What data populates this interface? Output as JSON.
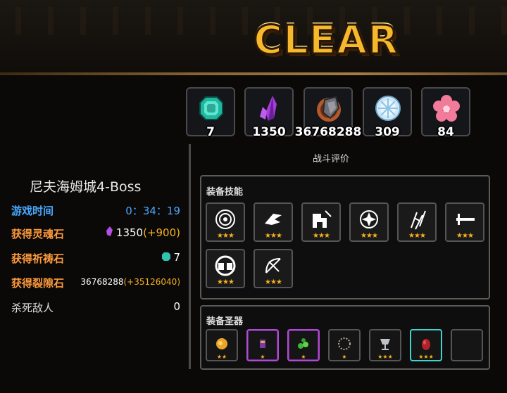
{
  "banner": {
    "clear_text": "CLEAR"
  },
  "resources": [
    {
      "icon": "teal-gem-icon",
      "value": "7"
    },
    {
      "icon": "purple-crystal-icon",
      "value": "1350"
    },
    {
      "icon": "rift-stone-icon",
      "value": "36768288"
    },
    {
      "icon": "snowflake-orb-icon",
      "value": "309"
    },
    {
      "icon": "pink-flower-icon",
      "value": "84"
    }
  ],
  "rating_label": "战斗评价",
  "stage": {
    "title": "尼夫海姆城4-Boss",
    "rows": [
      {
        "label": "游戏时间",
        "value": "0：34：19",
        "label_color": "#4aa7ff",
        "value_color": "#4aa7ff"
      },
      {
        "label": "获得灵魂石",
        "value": "1350",
        "bonus": "(+900)",
        "label_color": "#ff9b3d"
      },
      {
        "label": "获得祈祷石",
        "value": "7",
        "label_color": "#ff9b3d"
      },
      {
        "label": "获得裂隙石",
        "value": "36768288",
        "bonus": "(+35126040)",
        "label_color": "#ff9b3d"
      },
      {
        "label": "杀死敌人",
        "value": "0",
        "label_color": "#e0e0e0"
      }
    ]
  },
  "skills_panel": {
    "title": "装备技能",
    "skills": [
      {
        "icon": "target-eye-icon",
        "stars": "★★★"
      },
      {
        "icon": "wing-dash-icon",
        "stars": "★★★"
      },
      {
        "icon": "strike-fist-icon",
        "stars": "★★★"
      },
      {
        "icon": "shuriken-spin-icon",
        "stars": "★★★"
      },
      {
        "icon": "daggers-rain-icon",
        "stars": "★★★"
      },
      {
        "icon": "thrust-sword-icon",
        "stars": "★★★"
      },
      {
        "icon": "helm-shield-icon",
        "stars": "★★★"
      },
      {
        "icon": "bow-arrow-icon",
        "stars": "★★★"
      }
    ]
  },
  "relics_panel": {
    "title": "装备圣器",
    "relics": [
      {
        "icon": "golden-lion-icon",
        "stars": "★★",
        "frame": "normal"
      },
      {
        "icon": "purple-idol-icon",
        "stars": "★",
        "frame": "purple"
      },
      {
        "icon": "green-seeds-icon",
        "stars": "★",
        "frame": "purple"
      },
      {
        "icon": "bead-necklace-icon",
        "stars": "★",
        "frame": "normal"
      },
      {
        "icon": "silver-chalice-icon",
        "stars": "★★★",
        "frame": "normal"
      },
      {
        "icon": "red-egg-icon",
        "stars": "★★★",
        "frame": "cyan"
      },
      {
        "icon": "empty-slot",
        "stars": "",
        "frame": "normal"
      }
    ]
  }
}
